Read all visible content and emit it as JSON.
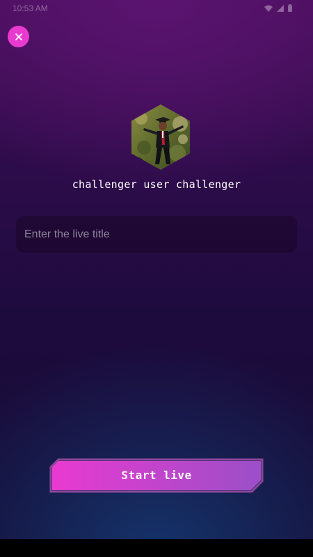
{
  "status_bar": {
    "time": "10:53 AM"
  },
  "header": {
    "close_icon": "close-icon",
    "close_color": "#e93ad0"
  },
  "profile": {
    "avatar_shape": "hexagon",
    "display_name": "challenger user challenger"
  },
  "live_form": {
    "title_input": {
      "value": "",
      "placeholder": "Enter the live title"
    }
  },
  "actions": {
    "start_label": "Start live",
    "start_gradient": [
      "#e93ad0",
      "#9b4fc8"
    ]
  },
  "colors": {
    "accent": "#e93ad0",
    "background_top": "#4a0f5c",
    "background_bottom": "#150d36"
  }
}
